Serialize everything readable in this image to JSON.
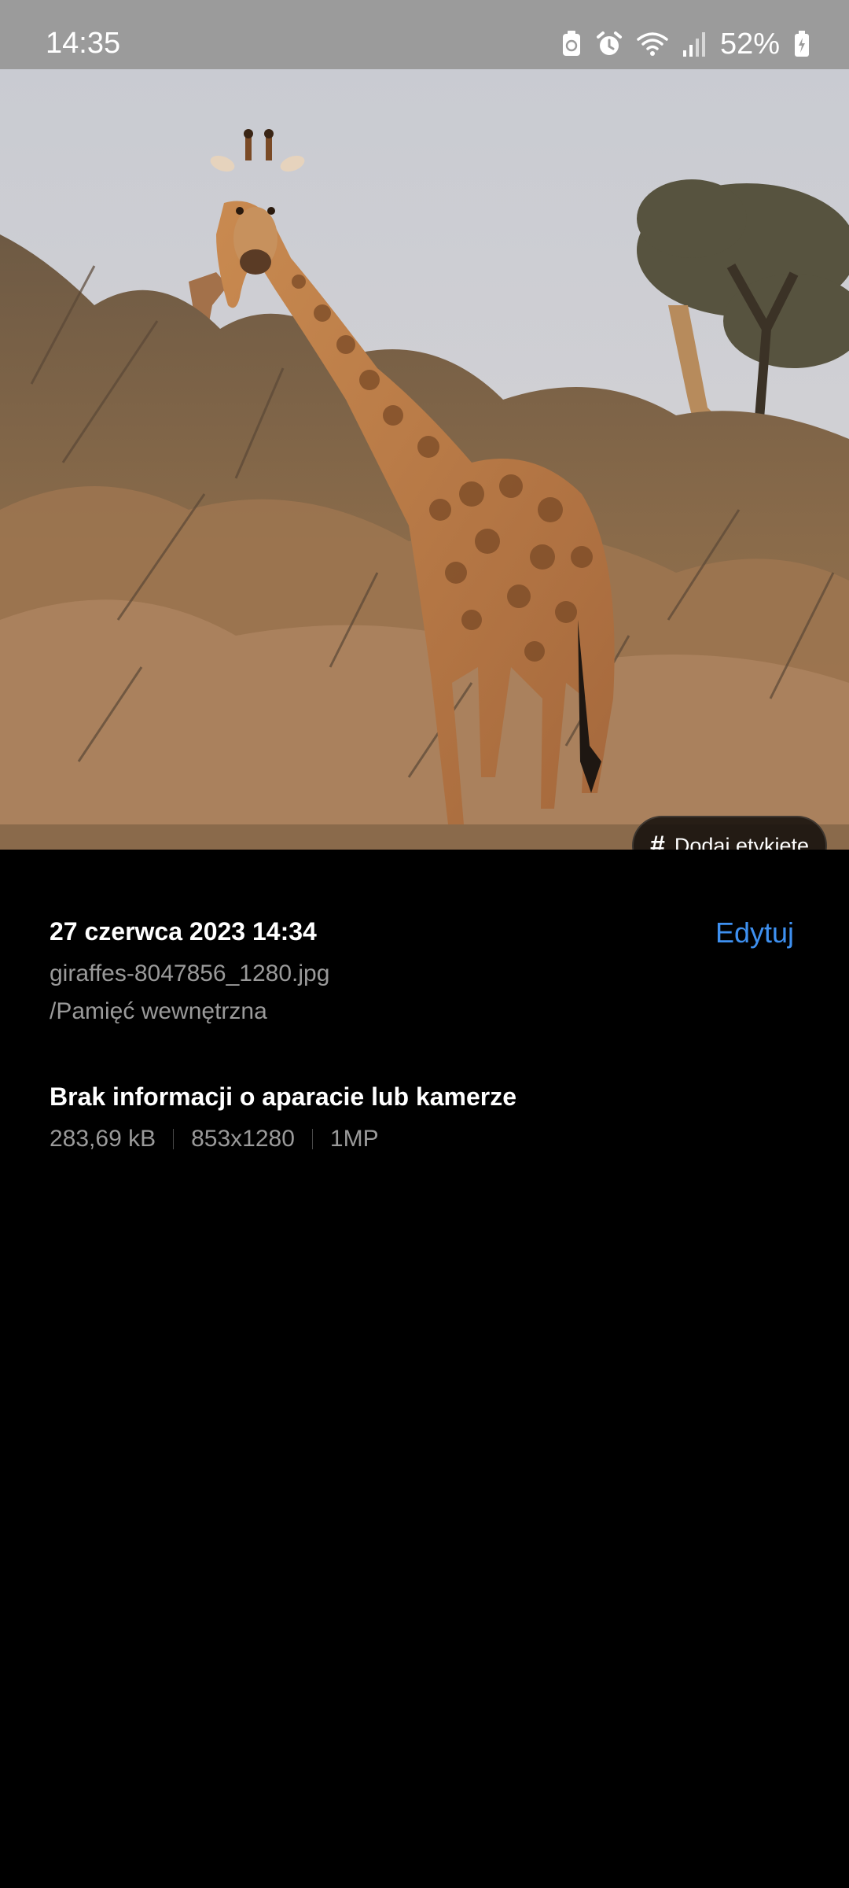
{
  "status_bar": {
    "time": "14:35",
    "battery_percent": "52%",
    "icons": [
      "battery-saver-icon",
      "alarm-icon",
      "wifi-icon",
      "signal-icon",
      "battery-charging-icon"
    ]
  },
  "photo": {
    "alt": "giraffes-8047856_1280.jpg",
    "tag_button": {
      "icon": "hash-icon",
      "label": "Dodaj etykietę"
    }
  },
  "details": {
    "date": "27 czerwca 2023 14:34",
    "edit_label": "Edytuj",
    "file_name": "giraffes-8047856_1280.jpg",
    "file_path": "/Pamięć wewnętrzna",
    "camera_info": "Brak informacji o aparacie lub kamerze",
    "file_size": "283,69 kB",
    "resolution": "853x1280",
    "megapixels": "1MP"
  },
  "colors": {
    "accent": "#3e90f0",
    "status_bar_bg": "#9b9b9b",
    "secondary_text": "#9a9a9a"
  }
}
